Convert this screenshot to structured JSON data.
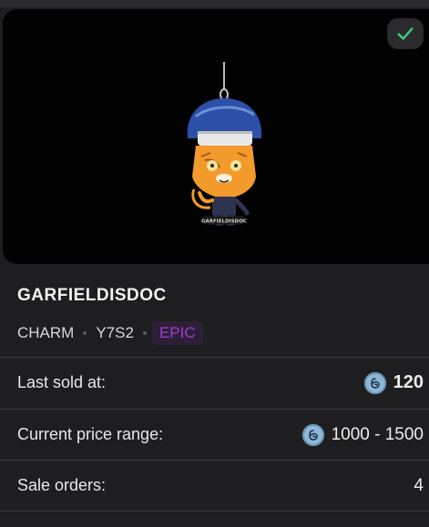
{
  "item": {
    "name": "GARFIELDISDOC",
    "type": "CHARM",
    "season": "Y7S2",
    "rarity": "EPIC",
    "charm_label": "GARFIELDISDOC"
  },
  "details": {
    "last_sold": {
      "label": "Last sold at:",
      "value": "120",
      "icon": "r6-credits-coin-icon"
    },
    "price_range": {
      "label": "Current price range:",
      "value": "1000 - 1500",
      "icon": "r6-credits-coin-icon"
    },
    "sale_orders": {
      "label": "Sale orders:",
      "value": "4"
    }
  },
  "status": {
    "owned_icon": "checkmark-icon"
  },
  "colors": {
    "background": "#1e1e20",
    "preview_bg": "#020202",
    "rarity_epic": "#9b3fd0",
    "check_green": "#3fcf7a",
    "coin": "#8fb8d8"
  }
}
